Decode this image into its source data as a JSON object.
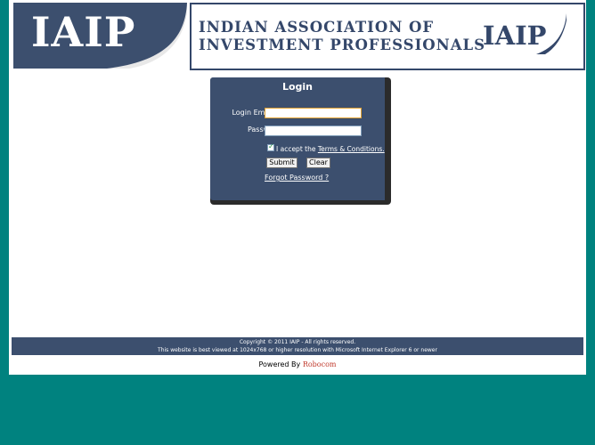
{
  "header": {
    "logo_text": "IAIP",
    "banner_line1": "INDIAN ASSOCIATION OF",
    "banner_line2": "INVESTMENT PROFESSIONALS",
    "banner_logo": "IAIP"
  },
  "login": {
    "title": "Login",
    "email_label": "Login EmailID:",
    "email_value": "",
    "password_label": "Password:",
    "password_value": "",
    "accept_prefix": "I accept the ",
    "terms_link": "Terms & Conditions.",
    "terms_checked": true,
    "submit_label": "Submit",
    "clear_label": "Clear",
    "forgot_link": "Forgot Password ?"
  },
  "footer": {
    "copyright": "Copyright © 2011 IAIP - All rights reserved.",
    "browser_note": "This website is best viewed at 1024x768 or higher resolution with Microsoft Internet Explorer 6 or newer",
    "powered_prefix": "Powered By ",
    "powered_brand": "Robocom"
  },
  "colors": {
    "background": "#00827f",
    "panel": "#3c4f6e",
    "brand_red": "#c0392b"
  }
}
